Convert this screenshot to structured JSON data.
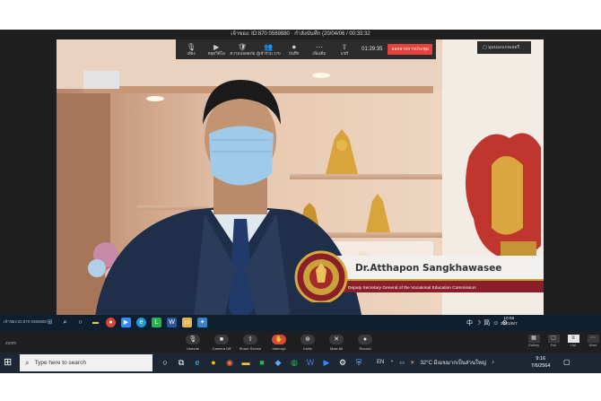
{
  "meeting": {
    "title": "เจ้าของ: ID:870 0569880 · กำลังบันทึก (20/04/06 / 00:33:32",
    "timer": "01:29:35",
    "leave_label": "ออกจากการประชุม",
    "side_label": "▢ มุมมองแกลเลอรี",
    "toolbar": [
      {
        "icon": "microphone-icon",
        "glyph": "🎙",
        "label": "เสียง"
      },
      {
        "icon": "video-icon",
        "glyph": "▶",
        "label": "หยุดวิดีโอ"
      },
      {
        "icon": "security-icon",
        "glyph": "🛡",
        "label": "ความปลอดภัย"
      },
      {
        "icon": "participants-icon",
        "glyph": "👥",
        "label": "ผู้เข้าร่วม 170"
      },
      {
        "icon": "record-icon",
        "glyph": "⏺",
        "label": "บันทึก"
      },
      {
        "icon": "more-icon",
        "glyph": "⋯",
        "label": "เพิ่มเติม"
      },
      {
        "icon": "share-icon",
        "glyph": "⇧",
        "label": "แชร์"
      }
    ]
  },
  "speaker": {
    "name": "Dr.Atthapon Sangkhawasee",
    "role": "Deputy Secretary General of the Vocational Education Commission"
  },
  "remote_taskbar": {
    "left_label": "เจ้าของ ID:870 0569880",
    "date": "2021/6/7",
    "time": "10:56"
  },
  "zoom_bar": {
    "logo_text": "zoom",
    "center": [
      {
        "icon": "microphone-icon",
        "glyph": "🎙",
        "label": "Unmute"
      },
      {
        "icon": "camera-icon",
        "glyph": "■",
        "label": "Camera Off"
      },
      {
        "icon": "share-screen-icon",
        "glyph": "⇧",
        "label": "Share Screen"
      },
      {
        "icon": "interrupt-icon",
        "glyph": "✋",
        "label": "Interrupt"
      },
      {
        "icon": "invite-icon",
        "glyph": "⊕",
        "label": "Invite"
      },
      {
        "icon": "mute-all-icon",
        "glyph": "✕",
        "label": "Mute All"
      },
      {
        "icon": "record-icon",
        "glyph": "●",
        "label": "Record"
      }
    ],
    "right": [
      {
        "icon": "gallery-icon",
        "glyph": "▦",
        "label": "Gallery"
      },
      {
        "icon": "full-icon",
        "glyph": "▢",
        "label": "Full"
      },
      {
        "icon": "list-icon",
        "glyph": "≡",
        "label": "List"
      },
      {
        "icon": "more-icon",
        "glyph": "⋯",
        "label": "More"
      }
    ]
  },
  "taskbar": {
    "search_placeholder": "Type here to search",
    "language": "EN",
    "weather": "32°C มีเมฆมากเป็นส่วนใหญ่",
    "time": "9:16",
    "date": "7/6/2564"
  }
}
